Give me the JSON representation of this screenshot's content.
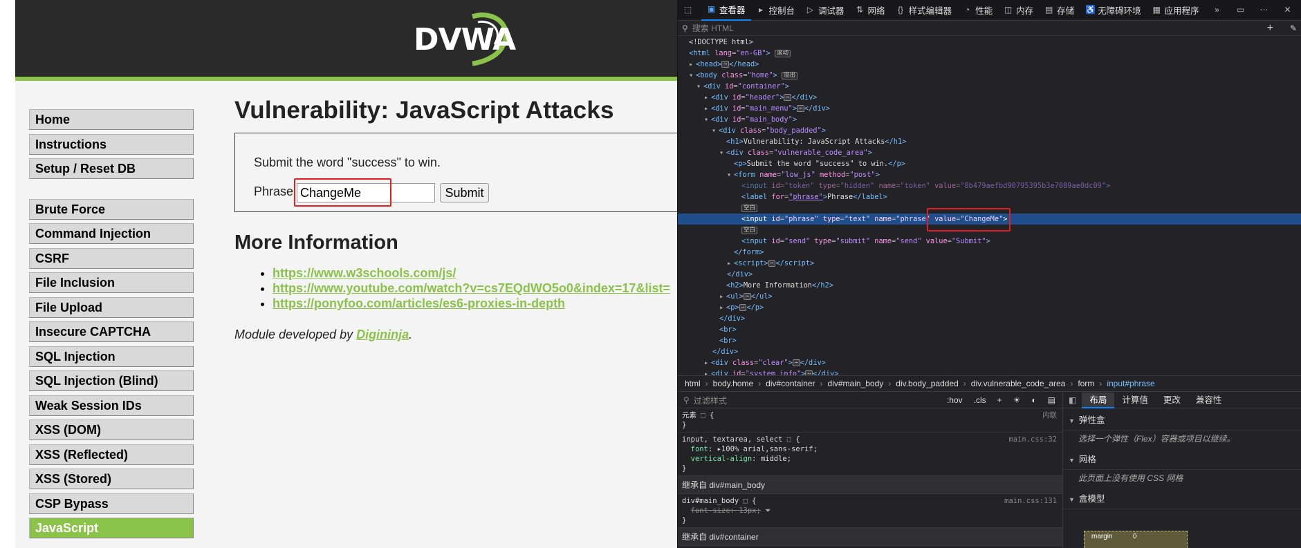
{
  "dvwa": {
    "logo_text": "DVWA",
    "menu_group1": [
      "Home",
      "Instructions",
      "Setup / Reset DB"
    ],
    "menu_group2": [
      "Brute Force",
      "Command Injection",
      "CSRF",
      "File Inclusion",
      "File Upload",
      "Insecure CAPTCHA",
      "SQL Injection",
      "SQL Injection (Blind)",
      "Weak Session IDs",
      "XSS (DOM)",
      "XSS (Reflected)",
      "XSS (Stored)",
      "CSP Bypass",
      "JavaScript"
    ],
    "selected_menu": "JavaScript",
    "heading": "Vulnerability: JavaScript Attacks",
    "instruction": "Submit the word \"success\" to win.",
    "phrase_label": "Phrase",
    "phrase_value": "ChangeMe",
    "submit_label": "Submit",
    "more_info_heading": "More Information",
    "links": [
      "https://www.w3schools.com/js/",
      "https://www.youtube.com/watch?v=cs7EQdWO5o0&index=17&list=",
      "https://ponyfoo.com/articles/es6-proxies-in-depth"
    ],
    "credit_prefix": "Module developed by ",
    "credit_link": "Digininja",
    "credit_suffix": ".",
    "accent_color": "#8bc34a",
    "highlight_color": "#e32020"
  },
  "devtools": {
    "tabs": [
      {
        "icon": "inspector-icon",
        "label": "查看器",
        "active": true
      },
      {
        "icon": "console-icon",
        "label": "控制台"
      },
      {
        "icon": "debugger-icon",
        "label": "调试器"
      },
      {
        "icon": "network-icon",
        "label": "网络"
      },
      {
        "icon": "style-editor-icon",
        "label": "样式编辑器"
      },
      {
        "icon": "performance-icon",
        "label": "性能"
      },
      {
        "icon": "memory-icon",
        "label": "内存"
      },
      {
        "icon": "storage-icon",
        "label": "存储"
      },
      {
        "icon": "accessibility-icon",
        "label": "无障碍环境"
      },
      {
        "icon": "application-icon",
        "label": "应用程序"
      }
    ],
    "search_placeholder": "搜索 HTML",
    "badges": {
      "scroll": "滚动",
      "overflow": "溢出",
      "whitespace": "空白"
    },
    "breadcrumb": [
      "html",
      "body.home",
      "div#container",
      "div#main_body",
      "div.body_padded",
      "div.vulnerable_code_area",
      "form",
      "input#phrase"
    ],
    "rules_filter_placeholder": "过滤样式",
    "rules_tools": [
      ":hov",
      ".cls"
    ],
    "element_rule_label": "元素",
    "element_rule_source": "内联",
    "rule1": {
      "selector": "input, textarea, select",
      "source": "main.css:32",
      "props": [
        [
          "font",
          "100% arial,sans-serif"
        ],
        [
          "vertical-align",
          "middle"
        ]
      ]
    },
    "inherited1": "继承自 div#main_body",
    "rule2": {
      "selector": "div#main_body",
      "source": "main.css:131",
      "prop": "font-size: 13px;"
    },
    "inherited2": "继承自 div#container",
    "layout_tabs": [
      "布局",
      "计算值",
      "更改",
      "兼容性"
    ],
    "flex_title": "弹性盒",
    "flex_desc": "选择一个弹性（Flex）容器或项目以继续。",
    "grid_title": "网格",
    "grid_desc": "此页面上没有使用 CSS 网格",
    "boxmodel_title": "盒模型",
    "boxmodel_margin": "margin",
    "boxmodel_zero": "0"
  }
}
